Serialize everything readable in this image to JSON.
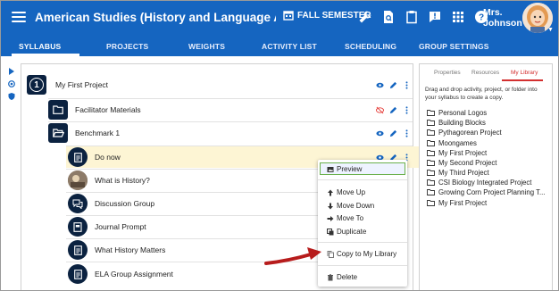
{
  "header": {
    "title": "American Studies (History and Language Arts) - E...",
    "semester": "FALL SEMESTER",
    "user_first": "Mrs.",
    "user_last": "Johnson"
  },
  "tabs": [
    "SYLLABUS",
    "PROJECTS",
    "WEIGHTS",
    "ACTIVITY LIST",
    "SCHEDULING",
    "GROUP SETTINGS"
  ],
  "tree": {
    "project_number": "1",
    "project_title": "My First Project",
    "folders": [
      "Facilitator Materials",
      "Benchmark 1"
    ],
    "activities": [
      "Do now",
      "What is History?",
      "Discussion Group",
      "Journal Prompt",
      "What History Matters",
      "ELA Group Assignment"
    ]
  },
  "context_menu": {
    "items": [
      "Preview",
      "Move Up",
      "Move Down",
      "Move To",
      "Duplicate",
      "Copy to My Library",
      "Delete"
    ]
  },
  "right_panel": {
    "tabs": [
      "Properties",
      "Resources",
      "My Library"
    ],
    "description": "Drag and drop activity, project, or folder into your syllabus to create a copy.",
    "items": [
      "Personal Logos",
      "Building Blocks",
      "Pythagorean Project",
      "Moongames",
      "My First Project",
      "My Second Project",
      "My Third Project",
      "CSI Biology Integrated Project",
      "Growing Corn Project Planning T...",
      "My First Project"
    ]
  },
  "colors": {
    "header_blue": "#1565c0",
    "icon_navy": "#0b2240",
    "row_highlight": "#fdf5d4",
    "arrow_red": "#c62828",
    "action_blue": "#1565c0"
  }
}
